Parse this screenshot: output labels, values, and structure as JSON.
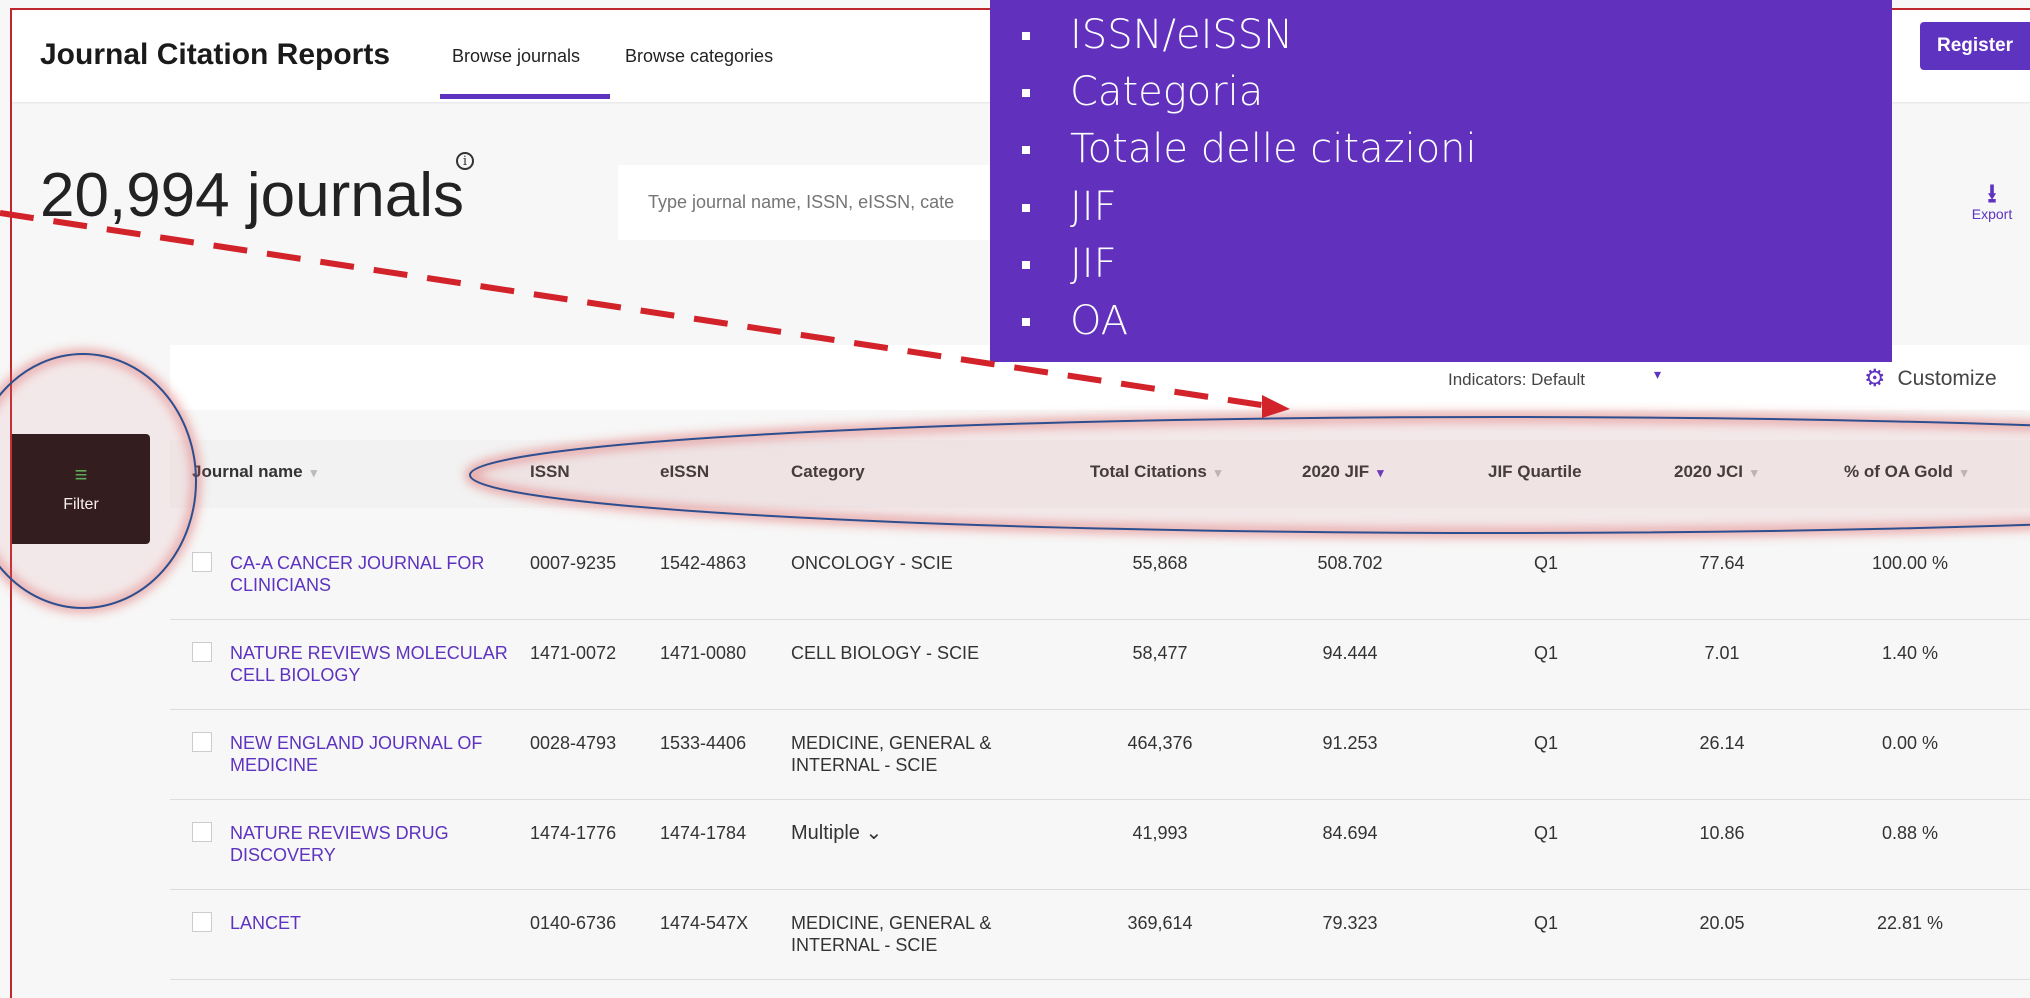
{
  "header": {
    "brand": "Journal Citation Reports",
    "tabs": [
      {
        "label": "Browse journals"
      },
      {
        "label": "Browse categories"
      }
    ],
    "register_label": "Register"
  },
  "summary": {
    "count": "20,994 journals",
    "info_icon": "i"
  },
  "search": {
    "placeholder": "Type journal name, ISSN, eISSN, cate"
  },
  "export": {
    "icon": "⭳",
    "label": "Export"
  },
  "toolbar": {
    "indicators_label": "Indicators: Default",
    "indicators_caret": "▾",
    "customize_icon": "⚙",
    "customize_label": "Customize"
  },
  "filter": {
    "icon": "≡",
    "label": "Filter"
  },
  "table": {
    "columns": [
      {
        "label": "Journal name",
        "sort": "▾"
      },
      {
        "label": "ISSN"
      },
      {
        "label": "eISSN"
      },
      {
        "label": "Category"
      },
      {
        "label": "Total Citations",
        "sort": "▾"
      },
      {
        "label": "2020 JIF",
        "sort": "▾"
      },
      {
        "label": "JIF Quartile"
      },
      {
        "label": "2020 JCI",
        "sort": "▾"
      },
      {
        "label": "% of OA Gold",
        "sort": "▾"
      }
    ],
    "rows": [
      {
        "name": "CA-A CANCER JOURNAL FOR CLINICIANS",
        "issn": "0007-9235",
        "eissn": "1542-4863",
        "category": "ONCOLOGY - SCIE",
        "citations": "55,868",
        "jif": "508.702",
        "quartile": "Q1",
        "jci": "77.64",
        "oa": "100.00 %"
      },
      {
        "name": "NATURE REVIEWS MOLECULAR CELL BIOLOGY",
        "issn": "1471-0072",
        "eissn": "1471-0080",
        "category": "CELL BIOLOGY - SCIE",
        "citations": "58,477",
        "jif": "94.444",
        "quartile": "Q1",
        "jci": "7.01",
        "oa": "1.40 %"
      },
      {
        "name": "NEW ENGLAND JOURNAL OF MEDICINE",
        "issn": "0028-4793",
        "eissn": "1533-4406",
        "category": "MEDICINE, GENERAL & INTERNAL - SCIE",
        "citations": "464,376",
        "jif": "91.253",
        "quartile": "Q1",
        "jci": "26.14",
        "oa": "0.00 %"
      },
      {
        "name": "NATURE REVIEWS DRUG DISCOVERY",
        "issn": "1474-1776",
        "eissn": "1474-1784",
        "category": "Multiple ⌄",
        "citations": "41,993",
        "jif": "84.694",
        "quartile": "Q1",
        "jci": "10.86",
        "oa": "0.88 %"
      },
      {
        "name": "LANCET",
        "issn": "0140-6736",
        "eissn": "1474-547X",
        "category": "MEDICINE, GENERAL & INTERNAL - SCIE",
        "citations": "369,614",
        "jif": "79.323",
        "quartile": "Q1",
        "jci": "20.05",
        "oa": "22.81 %"
      }
    ]
  },
  "overlay": {
    "items": [
      "ISSN/eISSN",
      "Categoria",
      "Totale delle citazioni",
      "JIF",
      "JIF",
      "OA"
    ]
  },
  "colors": {
    "accent": "#5e33bf",
    "overlay_bg": "#6131bd",
    "annotation_red": "#d2232a",
    "annotation_blue": "#2d4f8f"
  }
}
